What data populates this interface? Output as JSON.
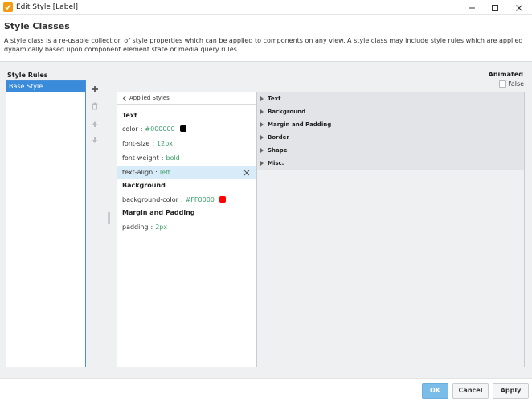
{
  "window": {
    "title": "Edit Style [Label]",
    "controls": [
      "minimize-icon",
      "maximize-icon",
      "close-icon"
    ]
  },
  "header": {
    "title": "Style Classes",
    "description": "A style class is a re-usable collection of style properties which can be applied to components on any view. A style class may include style rules which are applied dynamically based upon component element state or media query rules."
  },
  "style_rules": {
    "label": "Style Rules",
    "items": [
      {
        "label": "Base Style",
        "selected": true
      }
    ],
    "actions": [
      "add-icon",
      "delete-icon",
      "move-up-icon",
      "move-down-icon"
    ]
  },
  "animated": {
    "label": "Animated",
    "checked": false,
    "value_label": "false"
  },
  "applied": {
    "header": "Applied Styles",
    "sections": [
      {
        "title": "Text",
        "props": [
          {
            "key": "color",
            "value": "#000000",
            "swatch": "#000000"
          },
          {
            "key": "font-size",
            "value": "12px"
          },
          {
            "key": "font-weight",
            "value": "bold"
          },
          {
            "key": "text-align",
            "value": "left",
            "selected": true
          }
        ]
      },
      {
        "title": "Background",
        "props": [
          {
            "key": "background-color",
            "value": "#FF0000",
            "swatch": "#FF0000"
          }
        ]
      },
      {
        "title": "Margin and Padding",
        "props": [
          {
            "key": "padding",
            "value": "2px"
          }
        ]
      }
    ]
  },
  "categories": [
    "Text",
    "Background",
    "Margin and Padding",
    "Border",
    "Shape",
    "Misc."
  ],
  "footer": {
    "ok": "OK",
    "cancel": "Cancel",
    "apply": "Apply"
  },
  "colors": {
    "accent": "#3a8bd9",
    "ok_button": "#7bbde9",
    "value_text": "#3ea06a",
    "selected_row": "#d8ebf8",
    "app_icon": "#f39c12"
  }
}
